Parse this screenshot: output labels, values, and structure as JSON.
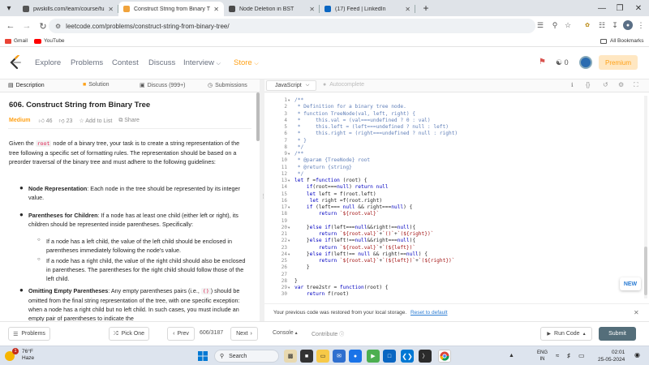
{
  "browser": {
    "tabs": [
      {
        "title": "pwskills.com/learn/course/full-",
        "fav_color": "#555555"
      },
      {
        "title": "Construct String from Binary Tre",
        "fav_color": "#f0a33c"
      },
      {
        "title": "Node Deletion in BST",
        "fav_color": "#4a4a4a"
      },
      {
        "title": "(17) Feed | LinkedIn",
        "fav_color": "#0a66c2"
      }
    ],
    "new_tab": "+",
    "url": "leetcode.com/problems/construct-string-from-binary-tree/",
    "bookmarks": [
      {
        "label": "Gmail",
        "icon": "gmail-icon"
      },
      {
        "label": "YouTube",
        "icon": "youtube-icon"
      }
    ],
    "all_bookmarks": "All Bookmarks"
  },
  "leetcode": {
    "nav": [
      "Explore",
      "Problems",
      "Contest",
      "Discuss",
      "Interview",
      "Store"
    ],
    "notif_count": "0",
    "premium": "Premium"
  },
  "left_tabs": [
    "Description",
    "Solution",
    "Discuss (999+)",
    "Submissions"
  ],
  "editor_tabs": {
    "language": "JavaScript",
    "autocomplete": "Autocomplete"
  },
  "problem": {
    "title": "606. Construct String from Binary Tree",
    "difficulty": "Medium",
    "likes": "46",
    "dislikes": "23",
    "add_to_list": "Add to List",
    "share": "Share",
    "intro_pre": "Given the ",
    "intro_code": "root",
    "intro_post": " node of a binary tree, your task is to create a string representation of the tree following a specific set of formatting rules. The representation should be based on a preorder traversal of the binary tree and must adhere to the following guidelines:",
    "b1_title": "Node Representation",
    "b1_text": ": Each node in the tree should be represented by its integer value.",
    "b2_title": "Parentheses for Children",
    "b2_text": ": If a node has at least one child (either left or right), its children should be represented inside parentheses. Specifically:",
    "sub1": "If a node has a left child, the value of the left child should be enclosed in parentheses immediately following the node's value.",
    "sub2": "If a node has a right child, the value of the right child should also be enclosed in parentheses. The parentheses for the right child should follow those of the left child.",
    "b3_title": "Omitting Empty Parentheses",
    "b3_pre": ": Any empty parentheses pairs (i.e., ",
    "b3_code": "()",
    "b3_post": ") should be omitted from the final string representation of the tree, with one specific exception: when a node has a right child but no left child. In such cases, you must include an empty pair of parentheses to indicate the"
  },
  "code": {
    "lines": [
      "/**",
      " * Definition for a binary tree node.",
      " * function TreeNode(val, left, right) {",
      " *     this.val = (val===undefined ? 0 : val)",
      " *     this.left = (left===undefined ? null : left)",
      " *     this.right = (right===undefined ? null : right)",
      " * }",
      " */",
      "/**",
      " * @param {TreeNode} root",
      " * @return {string}",
      " */",
      "let f =function (root) {",
      "    if(root===null) return null",
      "    let left = f(root.left)",
      "     let right =f(root.right)",
      "    if (left=== null && right===null) {",
      "        return `${root.val}`",
      "",
      "    }else if(left===null&&right!==null){",
      "        return `${root.val}`+`()`+`(${right})`",
      "    }else if(left!==null&&right===null){",
      "        return `${root.val}`+`(${left})`",
      "    }else if(left!== null && right!==null) {",
      "        return `${root.val}`+`(${left})`+`(${right})`",
      "    }",
      "",
      "}",
      "var tree2str = function(root) {",
      "    return f(root)"
    ],
    "folds": [
      1,
      9,
      13,
      17,
      20,
      22,
      24,
      29
    ]
  },
  "restore_msg": "Your previous code was restored from your local storage.",
  "reset_link": "Reset to default",
  "new_badge": "NEW",
  "footer": {
    "problems": "Problems",
    "pick_one": "Pick One",
    "prev": "Prev",
    "pager": "606/3187",
    "next": "Next",
    "console": "Console",
    "contribute": "Contribute",
    "run_code": "Run Code",
    "submit": "Submit"
  },
  "taskbar": {
    "weather_temp": "76°F",
    "weather_desc": "Haze",
    "search": "Search",
    "lang_top": "ENG",
    "lang_bottom": "IN",
    "time": "02:01",
    "date": "25-05-2024",
    "badge": "1"
  },
  "colors": {
    "accent": "#ffa116",
    "medium": "#ffa116",
    "submit_bg": "#546e7a",
    "premium_bg": "#ffa116"
  }
}
